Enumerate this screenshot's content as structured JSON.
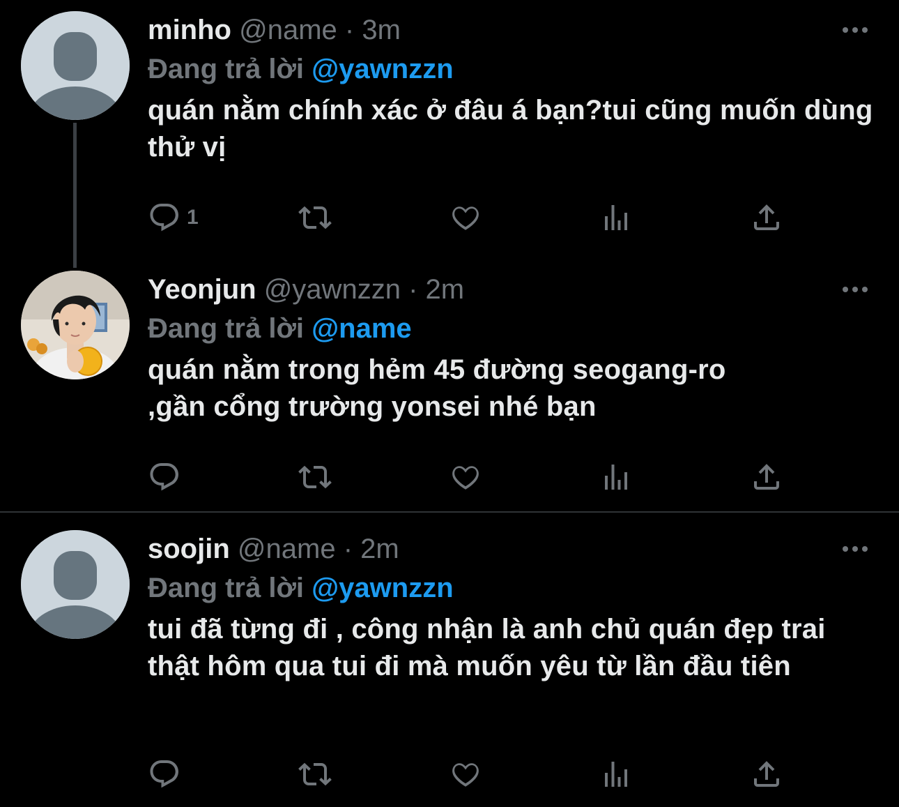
{
  "tweets": [
    {
      "display_name": "minho",
      "handle": "@name",
      "separator": "·",
      "time": "3m",
      "replying_label": "Đang trả lời",
      "replying_to": "@yawnzzn",
      "text": "quán nằm chính xác ở đâu á bạn?tui cũng muốn dùng thử vị",
      "reply_count": "1",
      "avatar": "default-avatar-icon"
    },
    {
      "display_name": "Yeonjun",
      "handle": "@yawnzzn",
      "separator": "·",
      "time": "2m",
      "replying_label": "Đang trả lời",
      "replying_to": "@name",
      "text": "quán nằm trong hẻm 45 đường seogang-ro ,gần cổng trường yonsei nhé bạn",
      "reply_count": "",
      "avatar": "profile-photo"
    },
    {
      "display_name": "soojin",
      "handle": "@name",
      "separator": "·",
      "time": "2m",
      "replying_label": "Đang trả lời",
      "replying_to": "@yawnzzn",
      "text": "tui đã từng đi , công nhận là anh chủ quán đẹp trai thật hôm qua tui đi mà muốn yêu từ lần đầu tiên",
      "reply_count": "",
      "avatar": "default-avatar-icon"
    }
  ],
  "icons": [
    "reply-icon",
    "retweet-icon",
    "like-icon",
    "views-icon",
    "share-icon",
    "more-icon"
  ],
  "colors": {
    "background": "#000000",
    "text": "#e7e9ea",
    "muted": "#71767b",
    "accent": "#1d9bf0",
    "avatar_bg": "#ccd6dd",
    "avatar_fg": "#66757f"
  }
}
